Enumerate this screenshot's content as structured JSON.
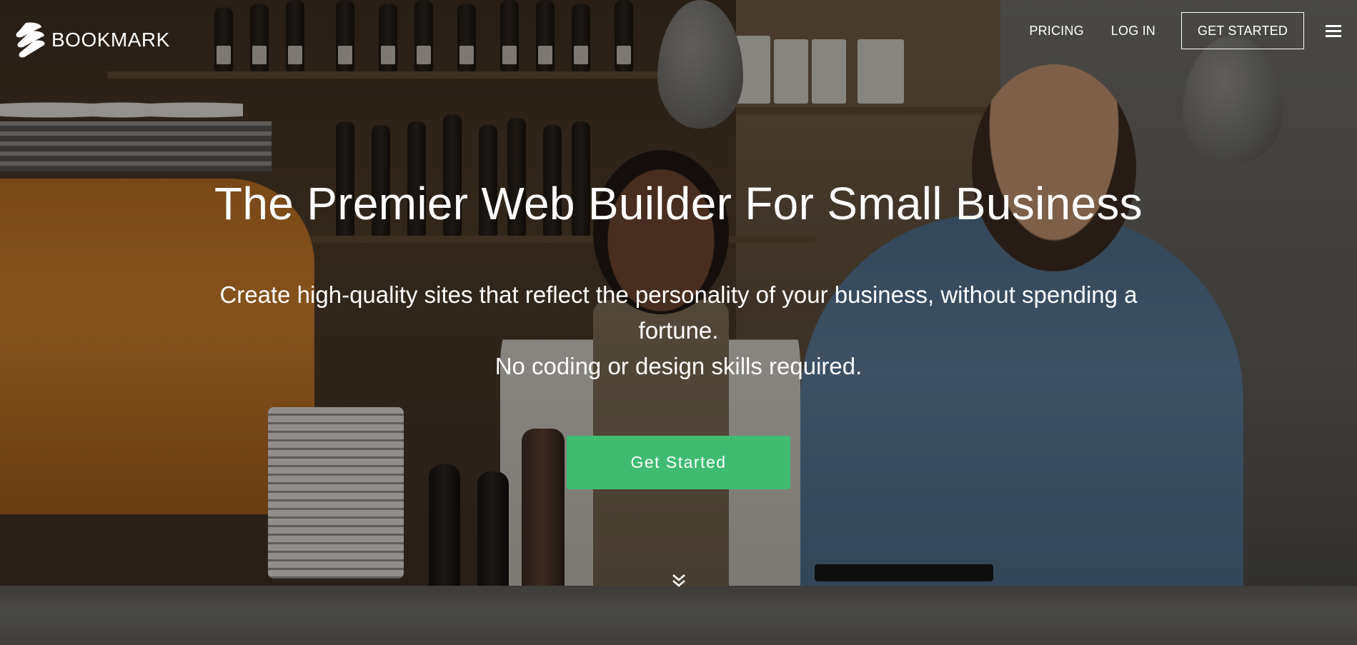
{
  "brand": {
    "logo_icon": "bookmark-logo-icon",
    "name": "BOOKMARK"
  },
  "nav": {
    "pricing": "PRICING",
    "login": "LOG IN",
    "get_started": "GET STARTED",
    "menu_icon": "hamburger-menu-icon"
  },
  "hero": {
    "headline": "The Premier Web Builder For Small Business",
    "subline_1": "Create high-quality sites that reflect the personality of your business, without spending a fortune.",
    "subline_2": "No coding or design skills required.",
    "cta_label": "Get Started",
    "scroll_icon": "double-chevron-down-icon"
  },
  "colors": {
    "accent": "#3fbb72",
    "text": "#ffffff"
  }
}
